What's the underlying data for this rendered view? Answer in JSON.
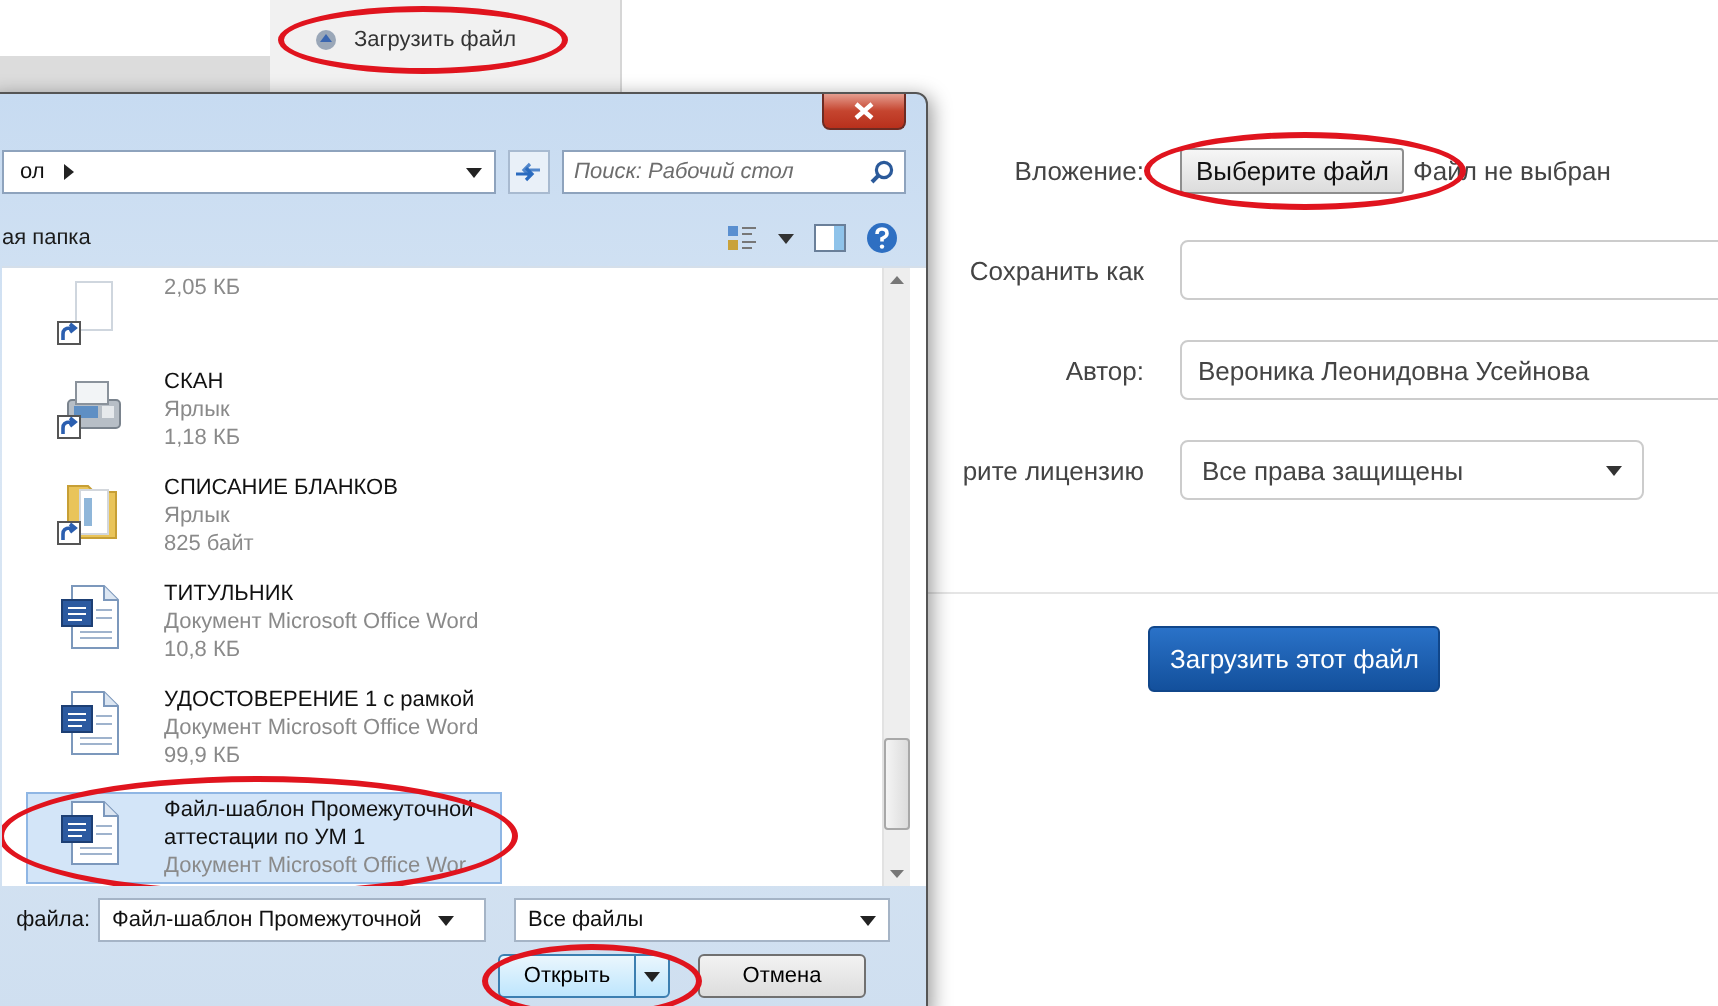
{
  "background_menu": {
    "items": [
      {
        "label": "Загрузить файл",
        "circled": true
      }
    ]
  },
  "upload_form": {
    "fields": [
      {
        "kind": "file",
        "label": "Вложение:",
        "button": "Выберите файл",
        "status": "Файл не выбран",
        "circled": true
      },
      {
        "kind": "text",
        "label": "Сохранить как"
      },
      {
        "kind": "text",
        "label": "Автор:",
        "value": "Вероника Леонидовна Усейнова"
      },
      {
        "kind": "select",
        "label": "рите лицензию",
        "value": "Все права защищены"
      }
    ],
    "submit": "Загрузить этот файл"
  },
  "open_dialog": {
    "address": "ол",
    "search": {
      "placeholder": "Поиск: Рабочий стол"
    },
    "folder_button": "ая папка",
    "files": [
      {
        "kind": "blank",
        "shortcut": true,
        "size": "2,05 КБ",
        "selected": false,
        "circled": false
      },
      {
        "kind": "fax",
        "shortcut": true,
        "name": "СКАН",
        "type": "Ярлык",
        "size": "1,18 КБ",
        "selected": false,
        "circled": false
      },
      {
        "kind": "folder",
        "shortcut": true,
        "name": "СПИСАНИЕ БЛАНКОВ",
        "type": "Ярлык",
        "size": "825 байт",
        "selected": false,
        "circled": false
      },
      {
        "kind": "word",
        "shortcut": false,
        "name": "ТИТУЛЬНИК",
        "type": "Документ Microsoft Office Word",
        "size": "10,8 КБ",
        "selected": false,
        "circled": false
      },
      {
        "kind": "word",
        "shortcut": false,
        "name": "УДОСТОВЕРЕНИЕ 1 с рамкой",
        "type": "Документ Microsoft Office Word",
        "size": "99,9 КБ",
        "selected": false,
        "circled": false
      },
      {
        "kind": "word",
        "shortcut": false,
        "name": "Файл-шаблон Промежуточной аттестации по УМ 1",
        "type": "Документ Microsoft Office Wor",
        "selected": true,
        "circled": true
      }
    ],
    "filename_label": "файла:",
    "filename": "Файл-шаблон Промежуточной",
    "filter": "Все файлы",
    "buttons": [
      {
        "label": "Открыть",
        "kind": "split",
        "circled": true
      },
      {
        "label": "Отмена",
        "kind": "plain",
        "circled": false
      }
    ]
  }
}
